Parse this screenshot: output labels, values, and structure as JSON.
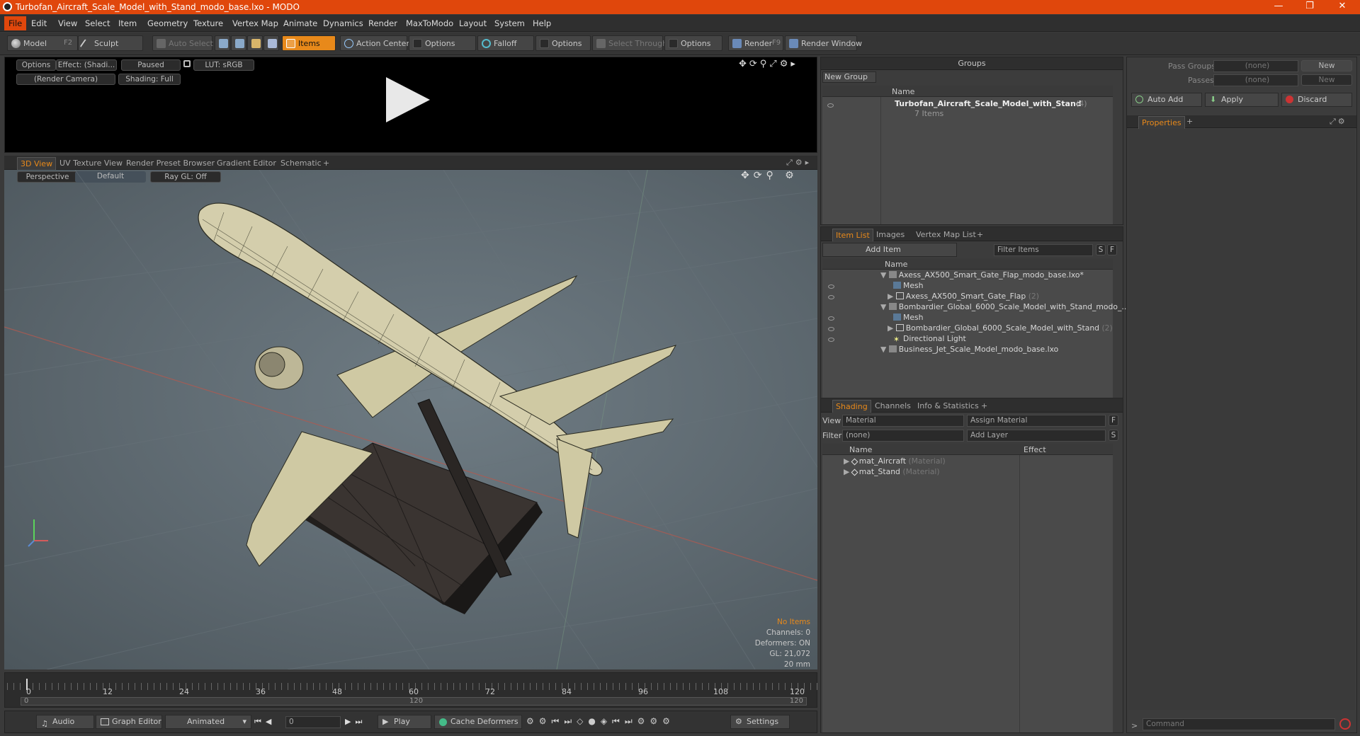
{
  "window": {
    "title": "Turbofan_Aircraft_Scale_Model_with_Stand_modo_base.lxo - MODO"
  },
  "menu": [
    "File",
    "Edit",
    "View",
    "Select",
    "Item",
    "Geometry",
    "Texture",
    "Vertex Map",
    "Animate",
    "Dynamics",
    "Render",
    "MaxToModo",
    "Layout",
    "System",
    "Help"
  ],
  "toolbar": {
    "model": "Model",
    "model_key": "F2",
    "sculpt": "Sculpt",
    "auto_select": "Auto Select",
    "items": "Items",
    "action_center": "Action Center",
    "options1": "Options",
    "falloff": "Falloff",
    "options2": "Options",
    "select_through": "Select Through",
    "options3": "Options",
    "render": "Render",
    "render_key": "F9",
    "render_window": "Render Window"
  },
  "preview": {
    "options": "Options",
    "effect": "Effect: (Shadi...",
    "paused": "Paused",
    "lut": "LUT: sRGB",
    "camera": "(Render Camera)",
    "shading": "Shading: Full"
  },
  "viewport_tabs": [
    "3D View",
    "UV Texture View",
    "Render Preset Browser",
    "Gradient Editor",
    "Schematic",
    "+"
  ],
  "viewport": {
    "perspective": "Perspective",
    "default": "Default",
    "raygl": "Ray GL: Off",
    "info": {
      "no_items": "No Items",
      "channels": "Channels: 0",
      "deformers": "Deformers: ON",
      "gl": "GL: 21,072",
      "unit": "20 mm"
    }
  },
  "timeline": {
    "ticks": [
      "0",
      "12",
      "24",
      "36",
      "48",
      "60",
      "72",
      "84",
      "96",
      "108",
      "120"
    ],
    "range_start": "0",
    "range_mid": "120",
    "range_end": "120"
  },
  "bottom_bar": {
    "audio": "Audio",
    "graph_editor": "Graph Editor",
    "animated": "Animated",
    "frame": "0",
    "play": "Play",
    "cache_deformers": "Cache Deformers",
    "settings": "Settings"
  },
  "groups": {
    "title": "Groups",
    "new_group": "New Group",
    "col_name": "Name",
    "item_name": "Turbofan_Aircraft_Scale_Model_with_Stand",
    "item_count": "(4)",
    "item_sub": "7 Items"
  },
  "item_list": {
    "tabs": [
      "Item List",
      "Images",
      "Vertex Map List",
      "+"
    ],
    "add_item": "Add Item",
    "filter": "Filter Items",
    "s": "S",
    "f": "F",
    "col_name": "Name",
    "rows": [
      {
        "label": "Axess_AX500_Smart_Gate_Flap_modo_base.lxo*",
        "suffix": "",
        "dim": false
      },
      {
        "label": "Mesh",
        "suffix": "",
        "dim": true
      },
      {
        "label": "Axess_AX500_Smart_Gate_Flap",
        "suffix": "(2)",
        "dim": false
      },
      {
        "label": "Bombardier_Global_6000_Scale_Model_with_Stand_modo_...",
        "suffix": "",
        "dim": false
      },
      {
        "label": "Mesh",
        "suffix": "",
        "dim": true
      },
      {
        "label": "Bombardier_Global_6000_Scale_Model_with_Stand",
        "suffix": "(2)",
        "dim": false
      },
      {
        "label": "Directional Light",
        "suffix": "",
        "dim": false
      },
      {
        "label": "Business_Jet_Scale_Model_modo_base.lxo",
        "suffix": "",
        "dim": false
      }
    ]
  },
  "shading": {
    "tabs": [
      "Shading",
      "Channels",
      "Info & Statistics",
      "+"
    ],
    "view_label": "View",
    "view_value": "Material",
    "assign": "Assign Material",
    "f": "F",
    "filter_label": "Filter",
    "filter_value": "(none)",
    "add_layer": "Add Layer",
    "s": "S",
    "col_name": "Name",
    "col_effect": "Effect",
    "rows": [
      {
        "label": "mat_Aircraft",
        "type": "(Material)"
      },
      {
        "label": "mat_Stand",
        "type": "(Material)"
      }
    ]
  },
  "right_panel": {
    "pass_groups": "Pass Groups",
    "pass_groups_value": "(none)",
    "new": "New",
    "passes": "Passes",
    "passes_value": "(none)",
    "new2": "New",
    "auto_add": "Auto Add",
    "apply": "Apply",
    "discard": "Discard",
    "properties": "Properties",
    "plus": "+",
    "command": "Command"
  },
  "colors": {
    "accent": "#e8891a",
    "title": "#e0470c",
    "fuselage": "#cfc9a3",
    "stand": "#2d2a28"
  }
}
